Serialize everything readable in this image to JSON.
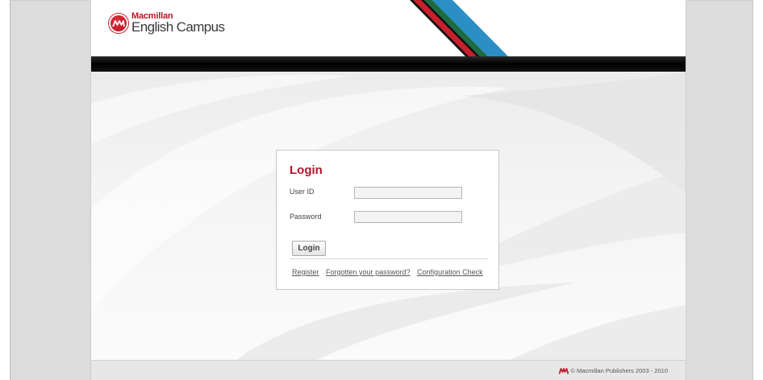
{
  "brand": {
    "line1": "Macmillan",
    "line2": "English Campus",
    "logo_icon": "macmillan-logo-icon",
    "accent_red": "#b51826",
    "stripe_blue": "#2b8fc6",
    "stripe_green": "#1b6b42",
    "stripe_black": "#111111"
  },
  "login": {
    "title": "Login",
    "user_id_label": "User ID",
    "user_id_value": "",
    "password_label": "Password",
    "password_value": "",
    "submit_label": "Login",
    "links": {
      "register": "Register",
      "forgotten": "Forgotten your password?",
      "config_check": "Configuration Check"
    }
  },
  "footer": {
    "copyright": "© Macmillan Publishers 2003 - 2010",
    "logo_icon": "macmillan-small-logo-icon"
  }
}
